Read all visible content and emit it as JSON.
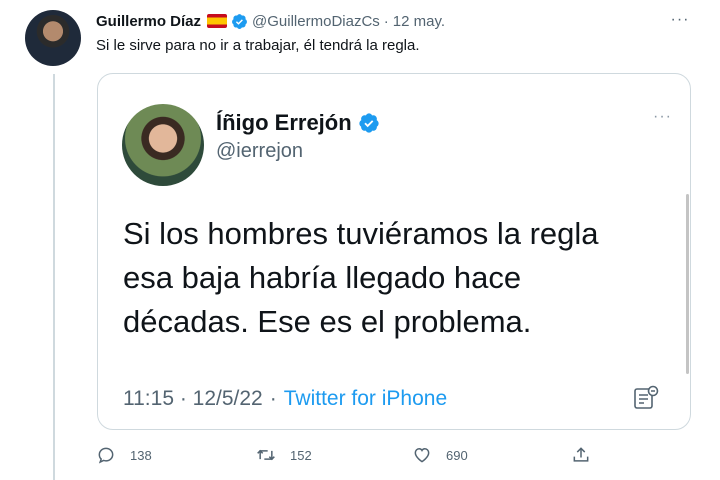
{
  "tweet": {
    "author_name": "Guillermo Díaz",
    "author_handle": "@GuillermoDiazCs",
    "separator": "·",
    "date": "12 may.",
    "text": "Si le sirve para no ir a trabajar, él tendrá la regla.",
    "more_label": "···",
    "flag_icon": "spain-flag-emoji",
    "verified_icon": "verified-badge-icon",
    "accent_color": "#1d9bf0"
  },
  "quoted": {
    "author_name": "Íñigo Errejón",
    "author_handle": "@ierrejon",
    "more_label": "···",
    "body_lines": [
      "Si los hombres tuviéramos la regla",
      "esa baja habría llegado hace",
      "décadas. Ese es el problema."
    ],
    "time": "11:15 · 12/5/22",
    "dot": "·",
    "source": "Twitter for iPhone",
    "analytics_icon": "analytics-icon"
  },
  "actions": {
    "reply_count": "138",
    "retweet_count": "152",
    "like_count": "690",
    "reply_icon": "reply-icon",
    "retweet_icon": "retweet-icon",
    "like_icon": "heart-icon",
    "share_icon": "share-icon"
  }
}
